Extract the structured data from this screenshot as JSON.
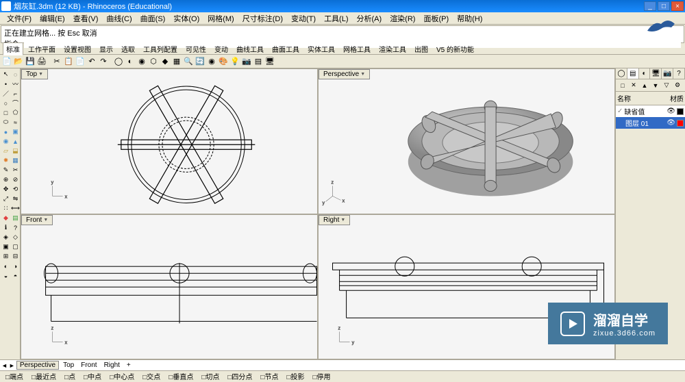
{
  "window": {
    "title": "烟灰缸.3dm (12 KB) - Rhinoceros (Educational)",
    "min": "_",
    "max": "□",
    "close": "×"
  },
  "menu": {
    "items": [
      "文件(F)",
      "编辑(E)",
      "查看(V)",
      "曲线(C)",
      "曲面(S)",
      "实体(O)",
      "网格(M)",
      "尺寸标注(D)",
      "变动(T)",
      "工具(L)",
      "分析(A)",
      "渲染(R)",
      "面板(P)",
      "帮助(H)"
    ]
  },
  "command": {
    "history": "正在建立网格... 按 Esc 取消",
    "prompt": "指令:"
  },
  "tabs_row1": {
    "items": [
      "标准",
      "工作平面",
      "设置视图",
      "显示",
      "选取",
      "工具列配置",
      "可见性",
      "变动",
      "曲线工具",
      "曲面工具",
      "实体工具",
      "网格工具",
      "渲染工具",
      "出图",
      "V5 的新功能"
    ]
  },
  "viewports": {
    "top": "Top",
    "perspective": "Perspective",
    "front": "Front",
    "right": "Right"
  },
  "right_panel": {
    "header_left": "名称",
    "header_right": "材质",
    "layer_default": "缺省值",
    "layer_01": "图层 01"
  },
  "view_tabs": {
    "items": [
      "Perspective",
      "Top",
      "Front",
      "Right",
      "+"
    ]
  },
  "statusbar": {
    "items": [
      "□端点",
      "□最近点",
      "□点",
      "□中点",
      "□中心点",
      "□交点",
      "□垂直点",
      "□切点",
      "□四分点",
      "□节点",
      "□投影",
      "□停用"
    ]
  },
  "watermark": {
    "cn": "溜溜自学",
    "url": "zixue.3d66.com"
  }
}
